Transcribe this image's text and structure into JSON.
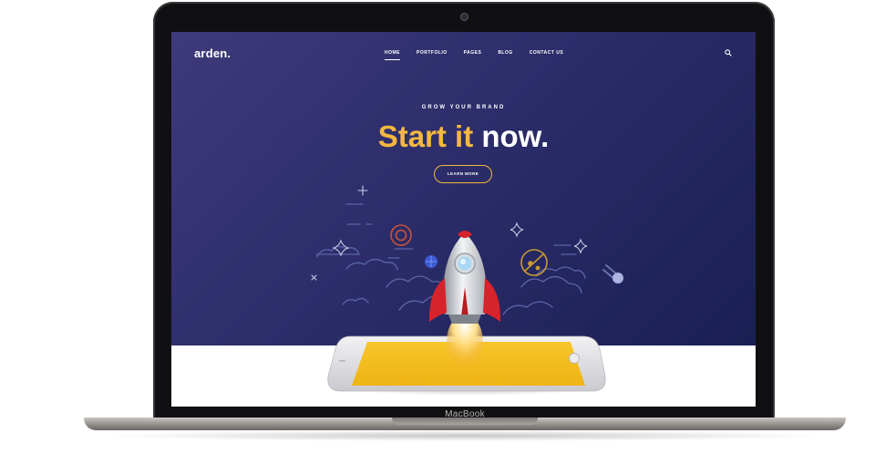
{
  "device": {
    "label": "MacBook"
  },
  "site": {
    "brand": "arden.",
    "nav": [
      "HOME",
      "PORTFOLIO",
      "PAGES",
      "BLOG",
      "CONTACT US"
    ],
    "hero": {
      "kicker": "GROW YOUR BRAND",
      "headline_accent": "Start it",
      "headline_rest": " now.",
      "cta": "LEARN MORE"
    }
  },
  "colors": {
    "hero_top": "#3f3a7a",
    "hero_bottom": "#1a1f54",
    "accent": "#f4b740",
    "rocket": "#d7232c",
    "phone_screen": "#f5bd1f"
  },
  "icons": [
    "search-icon",
    "rocket-icon",
    "target-icon",
    "planet-icon",
    "globe-icon",
    "meteor-icon",
    "sparkle-icon",
    "cloud-outline",
    "phone-device"
  ]
}
